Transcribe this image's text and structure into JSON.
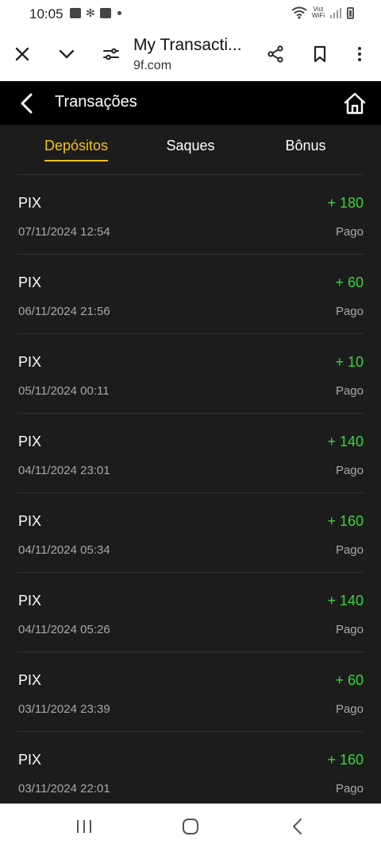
{
  "status_bar": {
    "time": "10:05",
    "voz_top": "Voz",
    "voz_bottom": "WiFi"
  },
  "browser": {
    "title": "My Transacti...",
    "url": "9f.com"
  },
  "header": {
    "title": "Transações"
  },
  "tabs": [
    {
      "label": "Depósitos",
      "active": true
    },
    {
      "label": "Saques",
      "active": false
    },
    {
      "label": "Bônus",
      "active": false
    }
  ],
  "transactions": [
    {
      "method": "PIX",
      "amount": "+ 180",
      "date": "07/11/2024 12:54",
      "status": "Pago"
    },
    {
      "method": "PIX",
      "amount": "+ 60",
      "date": "06/11/2024 21:56",
      "status": "Pago"
    },
    {
      "method": "PIX",
      "amount": "+ 10",
      "date": "05/11/2024 00:11",
      "status": "Pago"
    },
    {
      "method": "PIX",
      "amount": "+ 140",
      "date": "04/11/2024 23:01",
      "status": "Pago"
    },
    {
      "method": "PIX",
      "amount": "+ 160",
      "date": "04/11/2024 05:34",
      "status": "Pago"
    },
    {
      "method": "PIX",
      "amount": "+ 140",
      "date": "04/11/2024 05:26",
      "status": "Pago"
    },
    {
      "method": "PIX",
      "amount": "+ 60",
      "date": "03/11/2024 23:39",
      "status": "Pago"
    },
    {
      "method": "PIX",
      "amount": "+ 160",
      "date": "03/11/2024 22:01",
      "status": "Pago"
    }
  ],
  "colors": {
    "accent": "#f1c21b",
    "amount": "#3cd33c",
    "background": "#1c1c1c",
    "header": "#000000"
  }
}
